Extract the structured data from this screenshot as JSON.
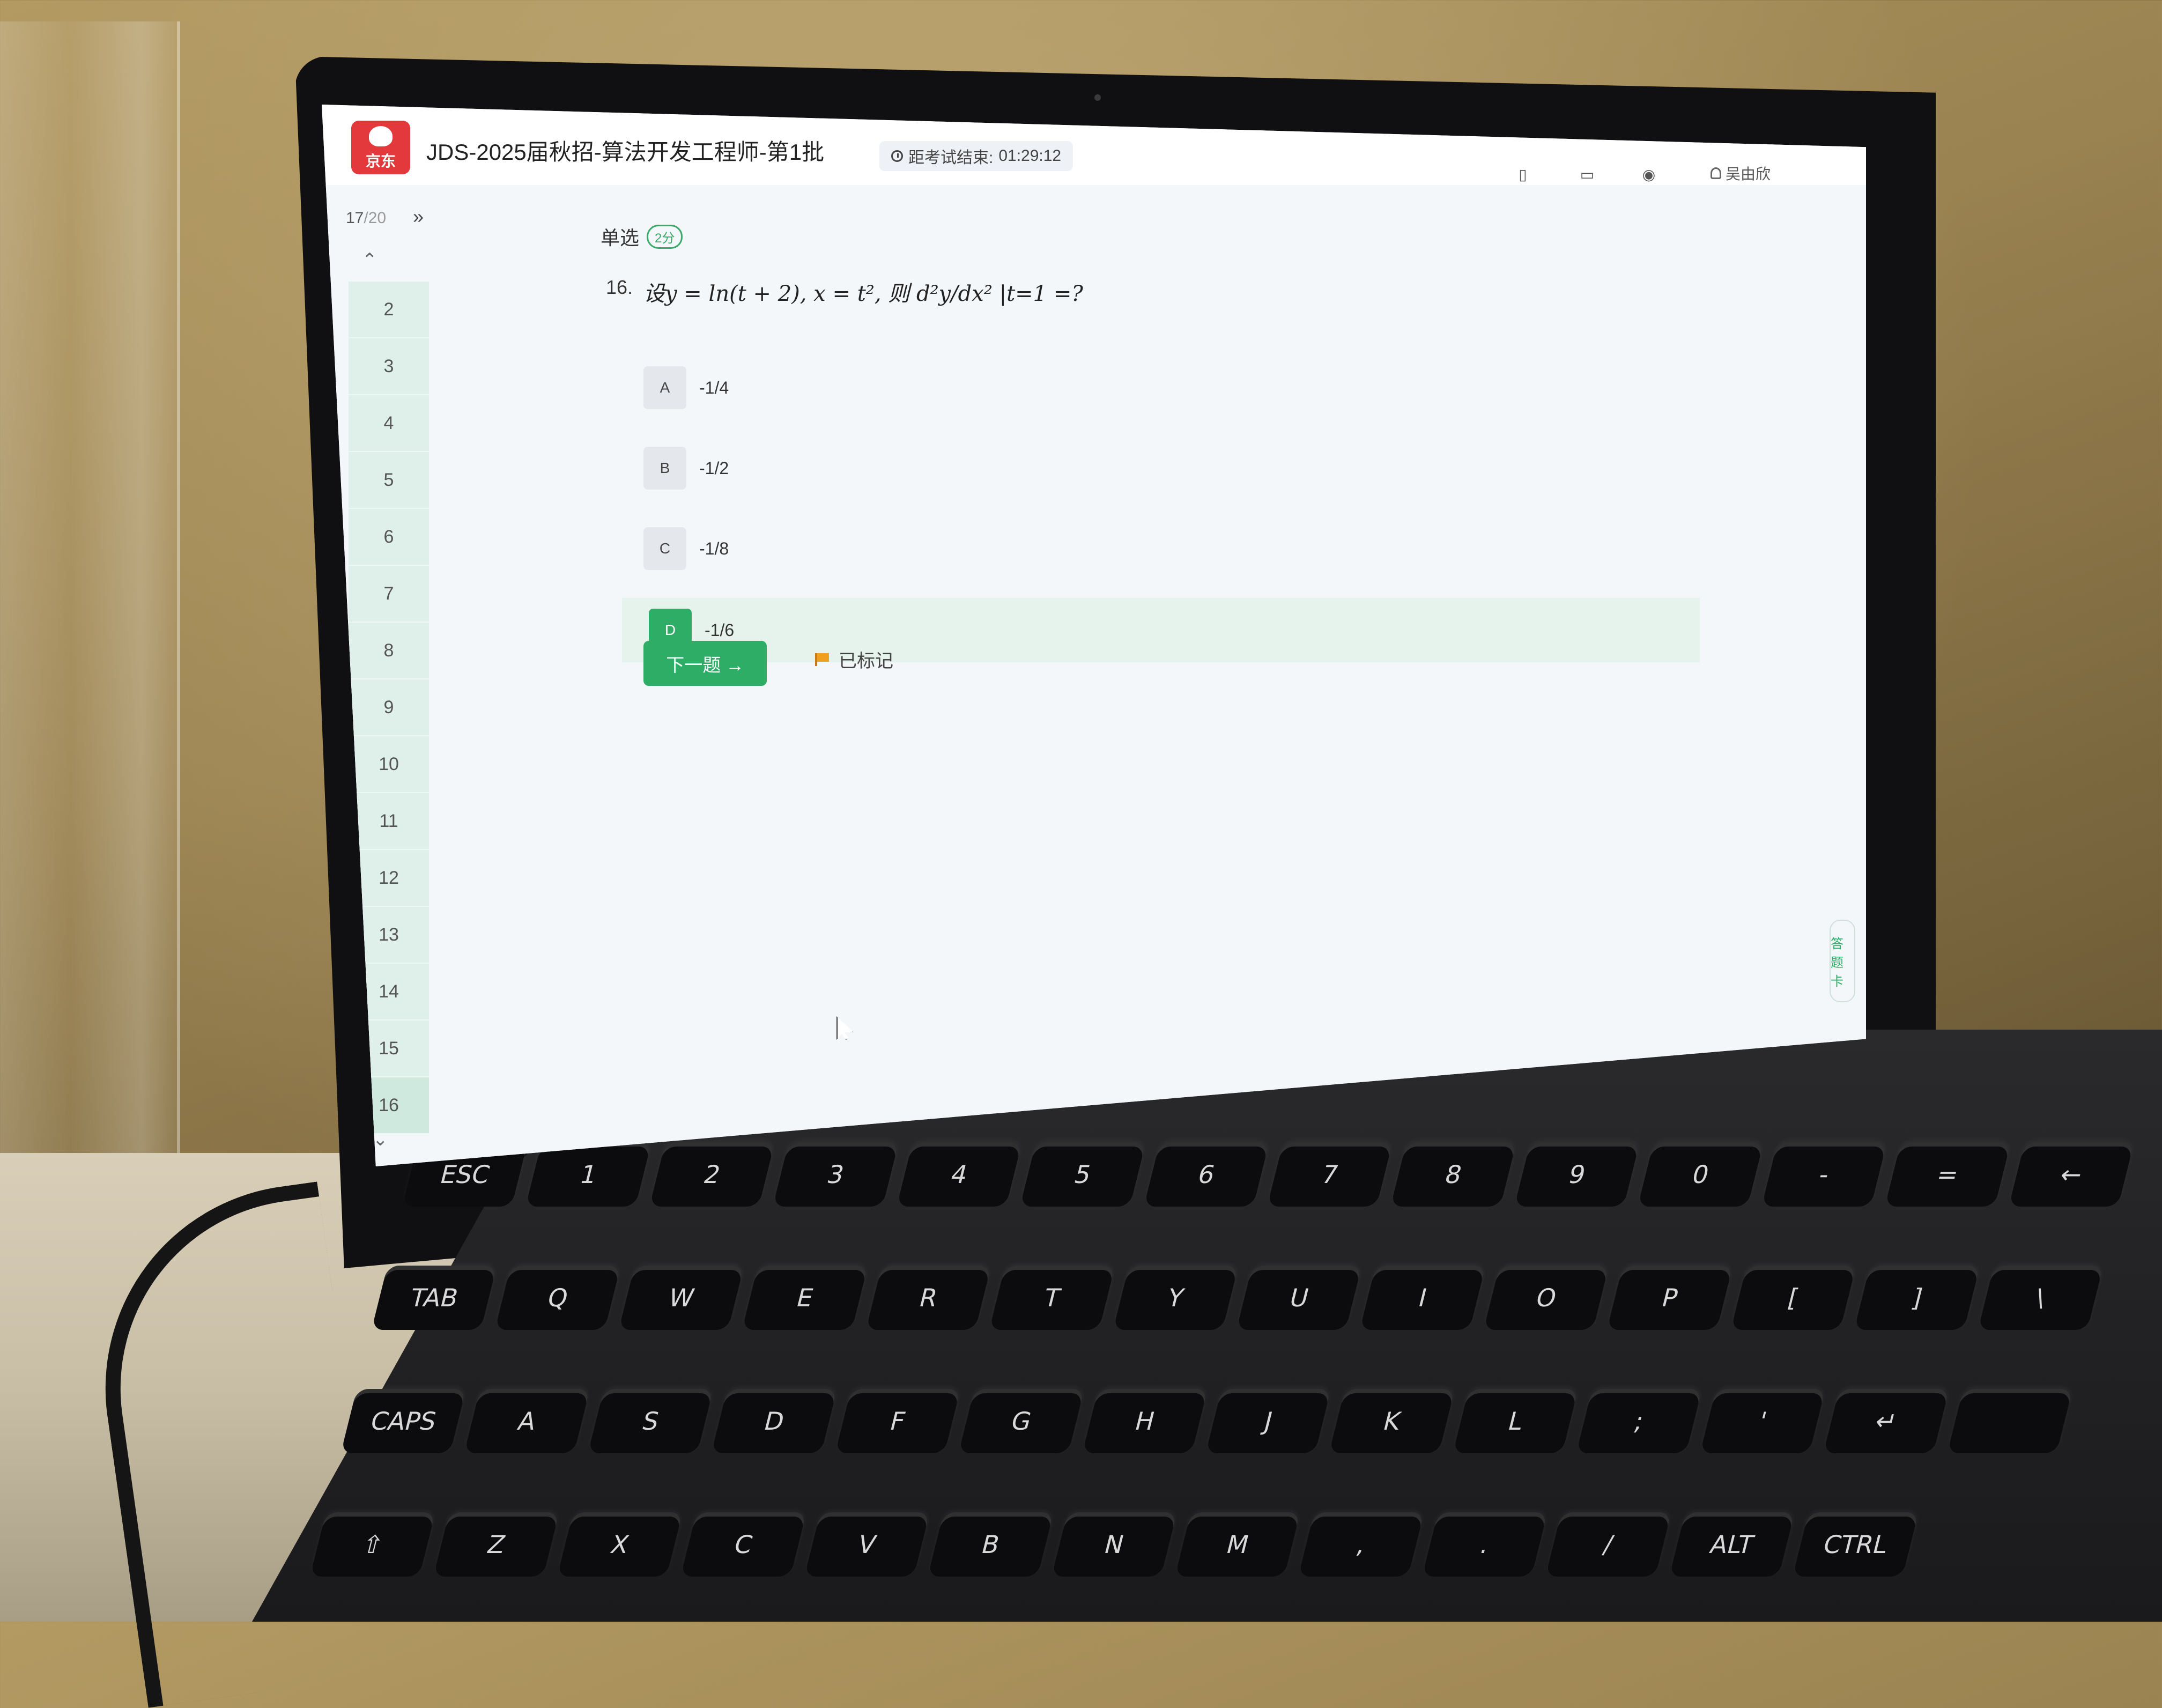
{
  "header": {
    "logo_text": "京东",
    "exam_title": "JDS-2025届秋招-算法开发工程师-第1批",
    "timer_label": "距考试结束:",
    "timer_value": "01:29:12",
    "user_name": "吴由欣"
  },
  "sidebar": {
    "progress_current": "17",
    "progress_total": "/20",
    "questions": [
      {
        "num": "2",
        "flagged": false
      },
      {
        "num": "3",
        "flagged": false
      },
      {
        "num": "4",
        "flagged": false
      },
      {
        "num": "5",
        "flagged": false
      },
      {
        "num": "6",
        "flagged": false
      },
      {
        "num": "7",
        "flagged": false
      },
      {
        "num": "8",
        "flagged": false
      },
      {
        "num": "9",
        "flagged": false
      },
      {
        "num": "10",
        "flagged": false
      },
      {
        "num": "11",
        "flagged": false
      },
      {
        "num": "12",
        "flagged": false
      },
      {
        "num": "13",
        "flagged": false
      },
      {
        "num": "14",
        "flagged": false
      },
      {
        "num": "15",
        "flagged": true
      },
      {
        "num": "16",
        "flagged": true
      }
    ]
  },
  "question": {
    "type": "单选",
    "score": "2分",
    "number": "16.",
    "text": "设y = ln(t + 2), x = t², 则 d²y/dx² |t=1 =?",
    "options": [
      {
        "letter": "A",
        "text": "-1/4",
        "selected": false
      },
      {
        "letter": "B",
        "text": "-1/2",
        "selected": false
      },
      {
        "letter": "C",
        "text": "-1/8",
        "selected": false
      },
      {
        "letter": "D",
        "text": "-1/6",
        "selected": true
      }
    ]
  },
  "actions": {
    "next_label": "下一题 →",
    "marked_label": "已标记"
  },
  "side_tab": {
    "text": "答题卡"
  },
  "colors": {
    "brand_red": "#e4393c",
    "accent_green": "#2dad66",
    "flag_orange": "#f0a020"
  }
}
